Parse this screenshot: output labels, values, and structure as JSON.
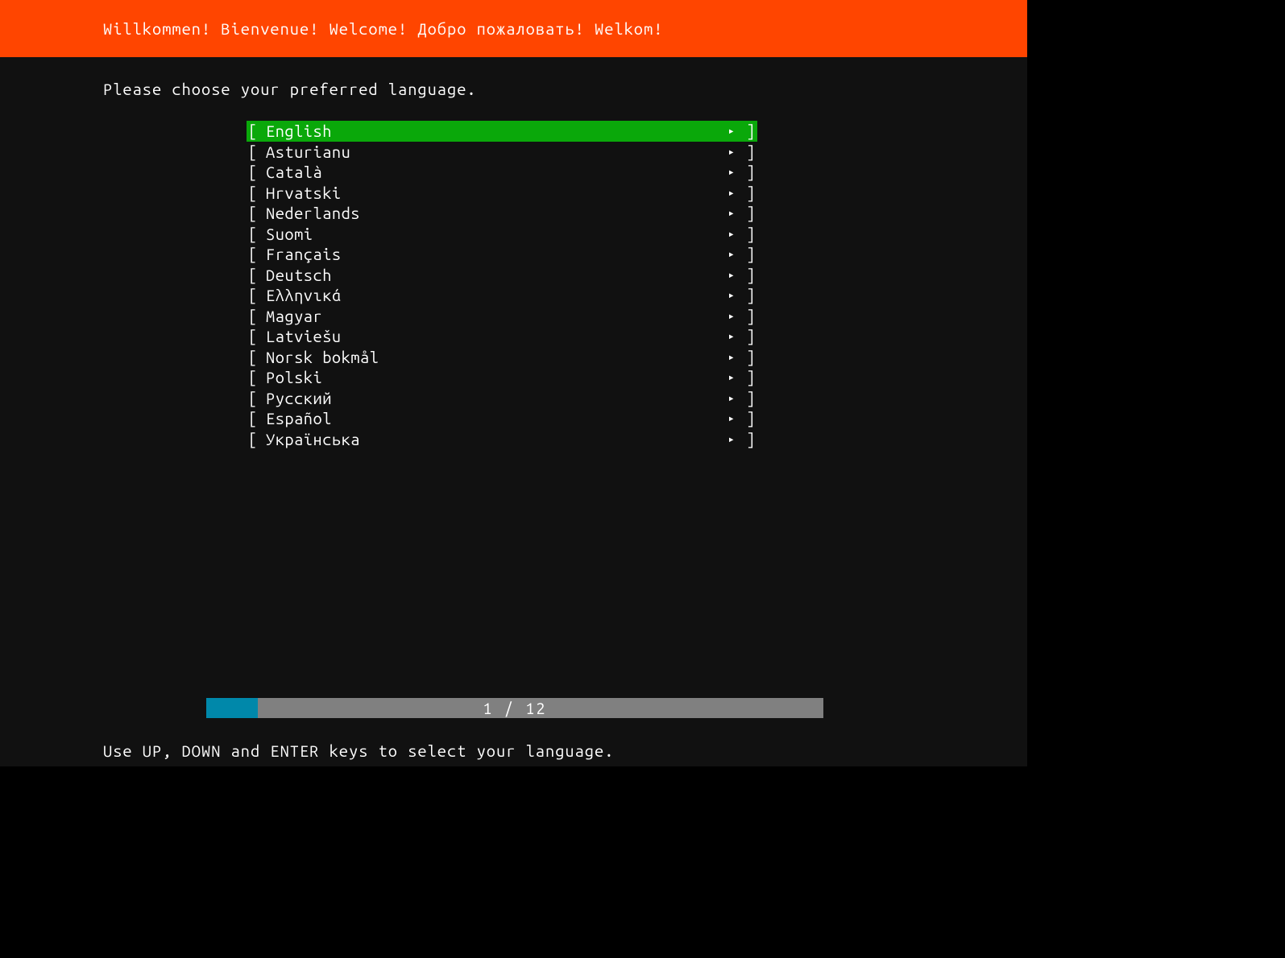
{
  "header": {
    "title": "Willkommen! Bienvenue! Welcome! Добро пожаловать! Welkom!"
  },
  "prompt": "Please choose your preferred language.",
  "languages": [
    {
      "label": "English",
      "selected": true
    },
    {
      "label": "Asturianu",
      "selected": false
    },
    {
      "label": "Català",
      "selected": false
    },
    {
      "label": "Hrvatski",
      "selected": false
    },
    {
      "label": "Nederlands",
      "selected": false
    },
    {
      "label": "Suomi",
      "selected": false
    },
    {
      "label": "Français",
      "selected": false
    },
    {
      "label": "Deutsch",
      "selected": false
    },
    {
      "label": "Ελληνικά",
      "selected": false
    },
    {
      "label": "Magyar",
      "selected": false
    },
    {
      "label": "Latviešu",
      "selected": false
    },
    {
      "label": "Norsk bokmål",
      "selected": false
    },
    {
      "label": "Polski",
      "selected": false
    },
    {
      "label": "Русский",
      "selected": false
    },
    {
      "label": "Español",
      "selected": false
    },
    {
      "label": "Українська",
      "selected": false
    }
  ],
  "progress": {
    "current": 1,
    "total": 12,
    "text": "1 / 12",
    "percent": 8.33
  },
  "footer": "Use UP, DOWN and ENTER keys to select your language.",
  "brackets": {
    "left": "[",
    "right": "]"
  },
  "arrow_glyph": "▸"
}
